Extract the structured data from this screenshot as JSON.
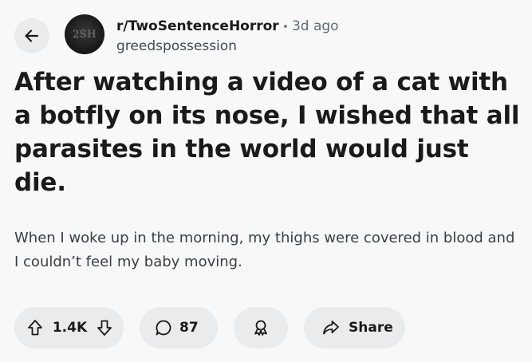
{
  "header": {
    "avatar_text": "2SH",
    "subreddit": "r/TwoSentenceHorror",
    "separator": "•",
    "time": "3d ago",
    "username": "greedspossession"
  },
  "post": {
    "title": "After watching a video of a cat with a botfly on its nose, I wished that all parasites in the world would just die.",
    "body": "When I woke up in the morning, my thighs were covered in blood and I couldn’t feel my baby moving."
  },
  "actions": {
    "vote_count": "1.4K",
    "comment_count": "87",
    "share_label": "Share"
  },
  "icons": {
    "back": "arrow-left-icon",
    "upvote": "upvote-arrow-icon",
    "downvote": "downvote-arrow-icon",
    "comment": "comment-bubble-icon",
    "award": "award-ribbon-icon",
    "share": "share-arrow-icon"
  }
}
